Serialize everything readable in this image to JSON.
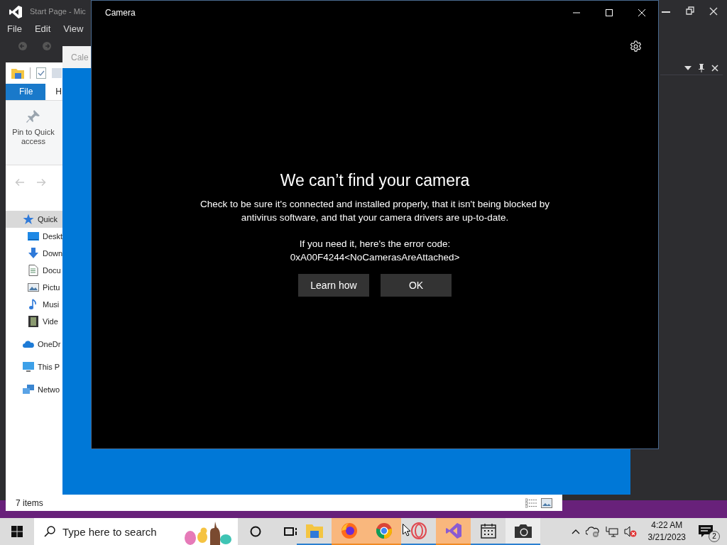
{
  "ide": {
    "title": "Start Page - Mic",
    "menu": [
      "File",
      "Edit",
      "View"
    ]
  },
  "explorer": {
    "tabs": [
      {
        "label": "File",
        "selected": true
      },
      {
        "label": "H",
        "selected": false
      }
    ],
    "ribbon_button": "Pin to Quick access",
    "nav": [
      {
        "label": "Quick",
        "kind": "star",
        "selected": true,
        "children": [
          {
            "label": "Deskt",
            "kind": "desktop",
            "selected": false
          },
          {
            "label": "Down",
            "kind": "download",
            "selected": false
          },
          {
            "label": "Docu",
            "kind": "document",
            "selected": false
          },
          {
            "label": "Pictu",
            "kind": "pictures",
            "selected": false
          },
          {
            "label": "Musi",
            "kind": "music",
            "selected": false
          },
          {
            "label": "Vide",
            "kind": "video",
            "selected": false
          }
        ]
      },
      {
        "label": "OneDr",
        "kind": "cloud",
        "selected": false
      },
      {
        "label": "This P",
        "kind": "pc",
        "selected": false
      },
      {
        "label": "Netwo",
        "kind": "network",
        "selected": false
      }
    ],
    "status": "7 items"
  },
  "calendar": {
    "title": "Cale"
  },
  "camera": {
    "title": "Camera",
    "heading": "We can’t find your camera",
    "message": "Check to be sure it's connected and installed properly, that it isn't being blocked by antivirus software, and that your camera drivers are up-to-date.",
    "error_intro": "If you need it, here's the error code:",
    "error_code": "0xA00F4244<NoCamerasAreAttached>",
    "buttons": [
      "Learn how",
      "OK"
    ]
  },
  "taskbar": {
    "search": {
      "placeholder": "Type here to search"
    },
    "apps": [
      {
        "kind": "explorer",
        "flashing": false,
        "selected": false
      },
      {
        "kind": "firefox",
        "flashing": true,
        "selected": false
      },
      {
        "kind": "chrome",
        "flashing": true,
        "selected": false
      },
      {
        "kind": "opera",
        "flashing": false,
        "selected": false
      },
      {
        "kind": "visualstudio",
        "flashing": true,
        "selected": false
      },
      {
        "kind": "calendar",
        "flashing": false,
        "selected": false
      },
      {
        "kind": "camera",
        "flashing": false,
        "selected": true
      }
    ],
    "time": "4:22 AM",
    "date": "3/21/2023",
    "notifications": "2"
  }
}
